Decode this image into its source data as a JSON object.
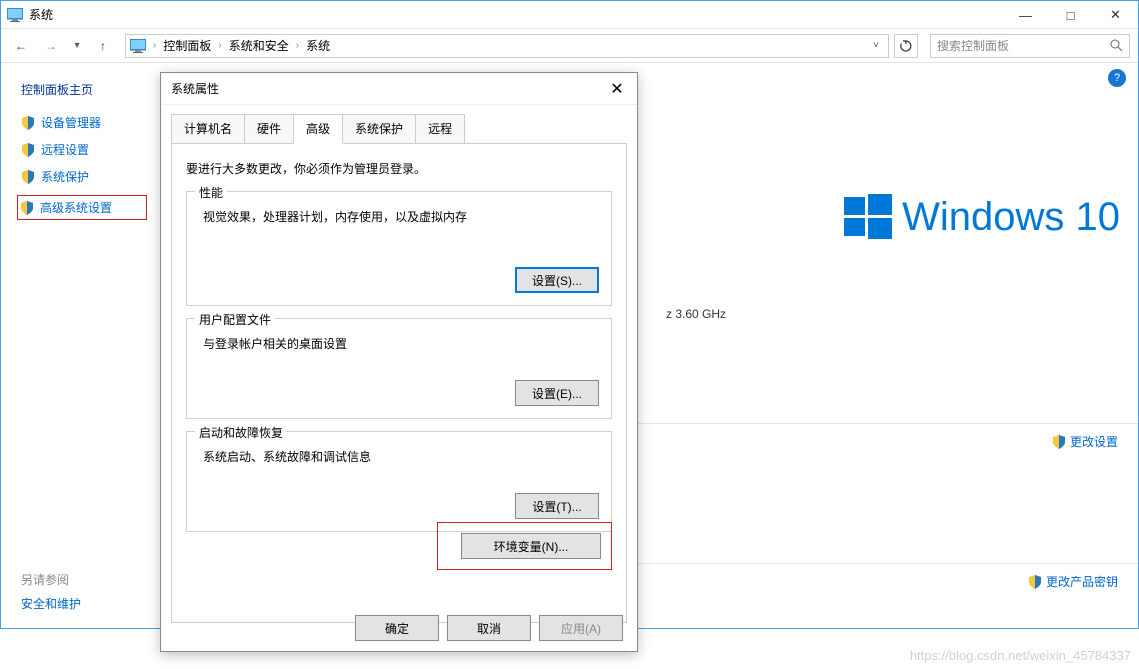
{
  "window": {
    "title": "系统",
    "controls": {
      "minimize": "—",
      "maximize": "□",
      "close": "✕"
    }
  },
  "nav": {
    "back": "←",
    "forward": "→",
    "up": "↑",
    "breadcrumb": [
      "控制面板",
      "系统和安全",
      "系统"
    ],
    "search_placeholder": "搜索控制面板"
  },
  "sidebar": {
    "title": "控制面板主页",
    "links": [
      {
        "label": "设备管理器"
      },
      {
        "label": "远程设置"
      },
      {
        "label": "系统保护"
      },
      {
        "label": "高级系统设置"
      }
    ],
    "see_also": "另请参阅",
    "safety": "安全和维护"
  },
  "main": {
    "brand": "Windows 10",
    "ghz": "z   3.60 GHz",
    "change_settings": "更改设置",
    "change_key": "更改产品密钥"
  },
  "dialog": {
    "title": "系统属性",
    "close": "✕",
    "tabs": [
      "计算机名",
      "硬件",
      "高级",
      "系统保护",
      "远程"
    ],
    "active_tab": 2,
    "note": "要进行大多数更改，你必须作为管理员登录。",
    "groups": {
      "perf": {
        "title": "性能",
        "text": "视觉效果，处理器计划，内存使用，以及虚拟内存",
        "btn": "设置(S)..."
      },
      "profile": {
        "title": "用户配置文件",
        "text": "与登录帐户相关的桌面设置",
        "btn": "设置(E)..."
      },
      "startup": {
        "title": "启动和故障恢复",
        "text": "系统启动、系统故障和调试信息",
        "btn": "设置(T)..."
      }
    },
    "env_btn": "环境变量(N)...",
    "buttons": {
      "ok": "确定",
      "cancel": "取消",
      "apply": "应用(A)"
    }
  },
  "watermark": "https://blog.csdn.net/weixin_45784337"
}
